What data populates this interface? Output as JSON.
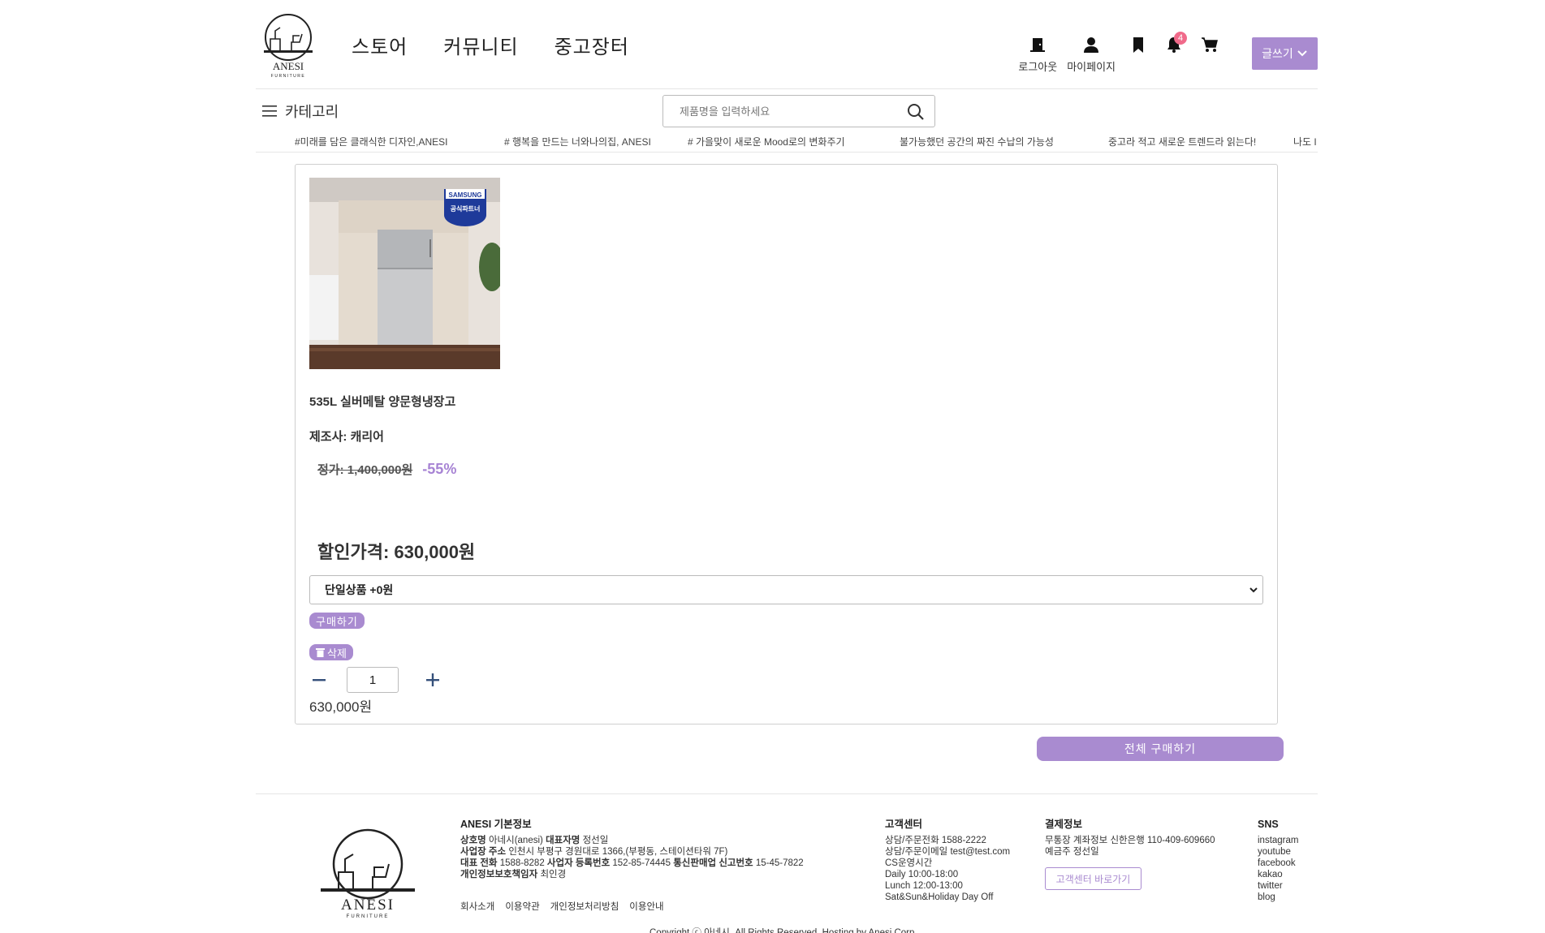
{
  "brand": {
    "name": "ANESI",
    "sub": "FURNITURE"
  },
  "nav": [
    "스토어",
    "커뮤니티",
    "중고장터"
  ],
  "util": {
    "logout": "로그아웃",
    "mypage": "마이페이지",
    "notification_count": "4",
    "write": "글쓰기"
  },
  "category": "카테고리",
  "search": {
    "placeholder": "제품명을 입력하세요"
  },
  "marquee": [
    "#미래를 담은 클래식한 디자인,ANESI",
    "# 행복을 만드는 너와나의집, ANESI",
    "# 가을맞이 새로운 Mood로의 변화주기",
    "불가능했던 공간의 짜진 수납의 가능성",
    "중고라 적고 새로운 트렌드라 읽는다!",
    "나도 I"
  ],
  "product": {
    "image_badge_top": "SAMSUNG",
    "image_badge_bottom": "공식파트너",
    "name": "535L 실버메탈 양문형냉장고",
    "maker": "제조사: 캐리어",
    "original_price": "정가: 1,400,000원",
    "discount": "-55%",
    "sale_price": "할인가격: 630,000원",
    "option": "단일상품 +0원",
    "buy_label": "구매하기",
    "delete_label": "삭제",
    "quantity": "1",
    "line_total": "630,000원"
  },
  "buy_all": "전체 구매하기",
  "footer": {
    "info_title": "ANESI 기본정보",
    "company_label": "상호명",
    "company": "아네시(anesi)",
    "ceo_label": "대표자명",
    "ceo": "정선일",
    "address_label": "사업장 주소",
    "address": "인천시 부평구 경원대로 1366,(부평동, 스테이션타워 7F)",
    "phone_label": "대표 전화",
    "phone": "1588-8282",
    "biz_label": "사업자 등록번호",
    "biz": "152-85-74445",
    "mail_order_label": "통신판매업 신고번호",
    "mail_order": "15-45-7822",
    "privacy_label": "개인정보보호책임자",
    "privacy": "최인경",
    "links": [
      "회사소개",
      "이용약관",
      "개인정보처리방침",
      "이용안내"
    ],
    "cs_title": "고객센터",
    "cs_lines": [
      "상담/주문전화 1588-2222",
      "상담/주문이메일 test@test.com",
      "CS운영시간",
      "Daily 10:00-18:00",
      "Lunch 12:00-13:00",
      "Sat&Sun&Holiday Day Off"
    ],
    "pay_title": "결제정보",
    "pay_lines": [
      "무통장 계좌정보 신한은행 110-409-609660",
      "예금주 정선일"
    ],
    "cs_button": "고객센터 바로가기",
    "sns_title": "SNS",
    "sns": [
      "instagram",
      "youtube",
      "facebook",
      "kakao",
      "twitter",
      "blog"
    ],
    "copyright": "Copyright ⓒ 아네시. All Rights Reserved. Hosting by Anesi Corp."
  },
  "colors": {
    "accent": "#a98bd0",
    "discount": "#a783d4",
    "badge": "#f06a8a"
  }
}
